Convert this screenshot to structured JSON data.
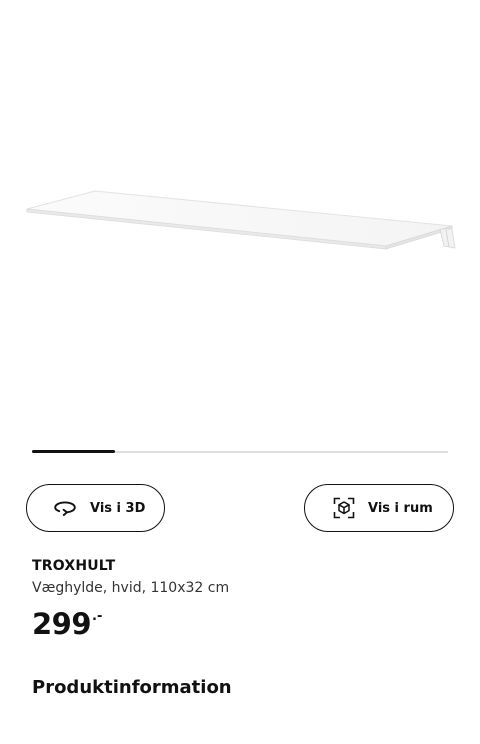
{
  "product_image": {
    "alt_icon": "wall-shelf-image"
  },
  "carousel": {
    "progress_fraction": 0.2
  },
  "actions": {
    "view_3d_label": "Vis i 3D",
    "view_3d_icon": "rotate-3d-icon",
    "view_room_label": "Vis i rum",
    "view_room_icon": "ar-cube-icon"
  },
  "product": {
    "name": "TROXHULT",
    "description": "Væghylde, hvid, 110x32 cm",
    "price_integer": "299",
    "price_decimal": ".-"
  },
  "sections": {
    "product_info_heading": "Produktinformation"
  },
  "colors": {
    "text": "#111111",
    "progress_track": "#dfdfdf",
    "progress_fill": "#111111"
  }
}
